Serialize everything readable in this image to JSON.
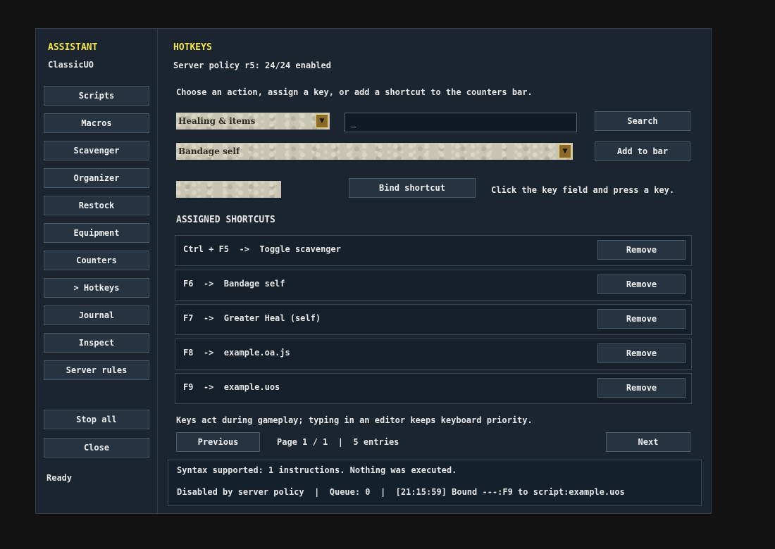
{
  "sidebar": {
    "title": "ASSISTANT",
    "subtitle": "ClassicUO",
    "items": [
      {
        "label": "Scripts"
      },
      {
        "label": "Macros"
      },
      {
        "label": "Scavenger"
      },
      {
        "label": "Organizer"
      },
      {
        "label": "Restock"
      },
      {
        "label": "Equipment"
      },
      {
        "label": "Counters"
      },
      {
        "label": "> Hotkeys"
      },
      {
        "label": "Journal"
      },
      {
        "label": "Inspect"
      },
      {
        "label": "Server rules"
      }
    ],
    "stop_all": "Stop all",
    "close": "Close",
    "status": "Ready"
  },
  "main": {
    "title": "HOTKEYS",
    "policy": "Server policy r5: 24/24 enabled",
    "instruction": "Choose an action, assign a key, or add a shortcut to the counters bar.",
    "category_select": "Healing & items",
    "key_input_value": "_",
    "search_button": "Search",
    "action_select": "Bandage self",
    "add_to_bar_button": "Add to bar",
    "bind_button": "Bind shortcut",
    "bind_hint": "Click the key field and press a key.",
    "assigned_heading": "ASSIGNED SHORTCUTS",
    "shortcuts": [
      {
        "text": "Ctrl + F5  ->  Toggle scavenger",
        "remove": "Remove"
      },
      {
        "text": "F6  ->  Bandage self",
        "remove": "Remove"
      },
      {
        "text": "F7  ->  Greater Heal (self)",
        "remove": "Remove"
      },
      {
        "text": "F8  ->  example.oa.js",
        "remove": "Remove"
      },
      {
        "text": "F9  ->  example.uos",
        "remove": "Remove"
      }
    ],
    "keys_note": "Keys act during gameplay; typing in an editor keeps keyboard priority.",
    "previous_button": "Previous",
    "page_info": "Page 1 / 1  |  5 entries",
    "next_button": "Next"
  },
  "console": {
    "line1": "Syntax supported: 1 instructions. Nothing was executed.",
    "line2": "Disabled by server policy  |  Queue: 0  |  [21:15:59] Bound ---:F9 to script:example.uos"
  },
  "colors": {
    "accent": "#f2e54a",
    "panel": "#1b2530",
    "button": "#263340"
  }
}
